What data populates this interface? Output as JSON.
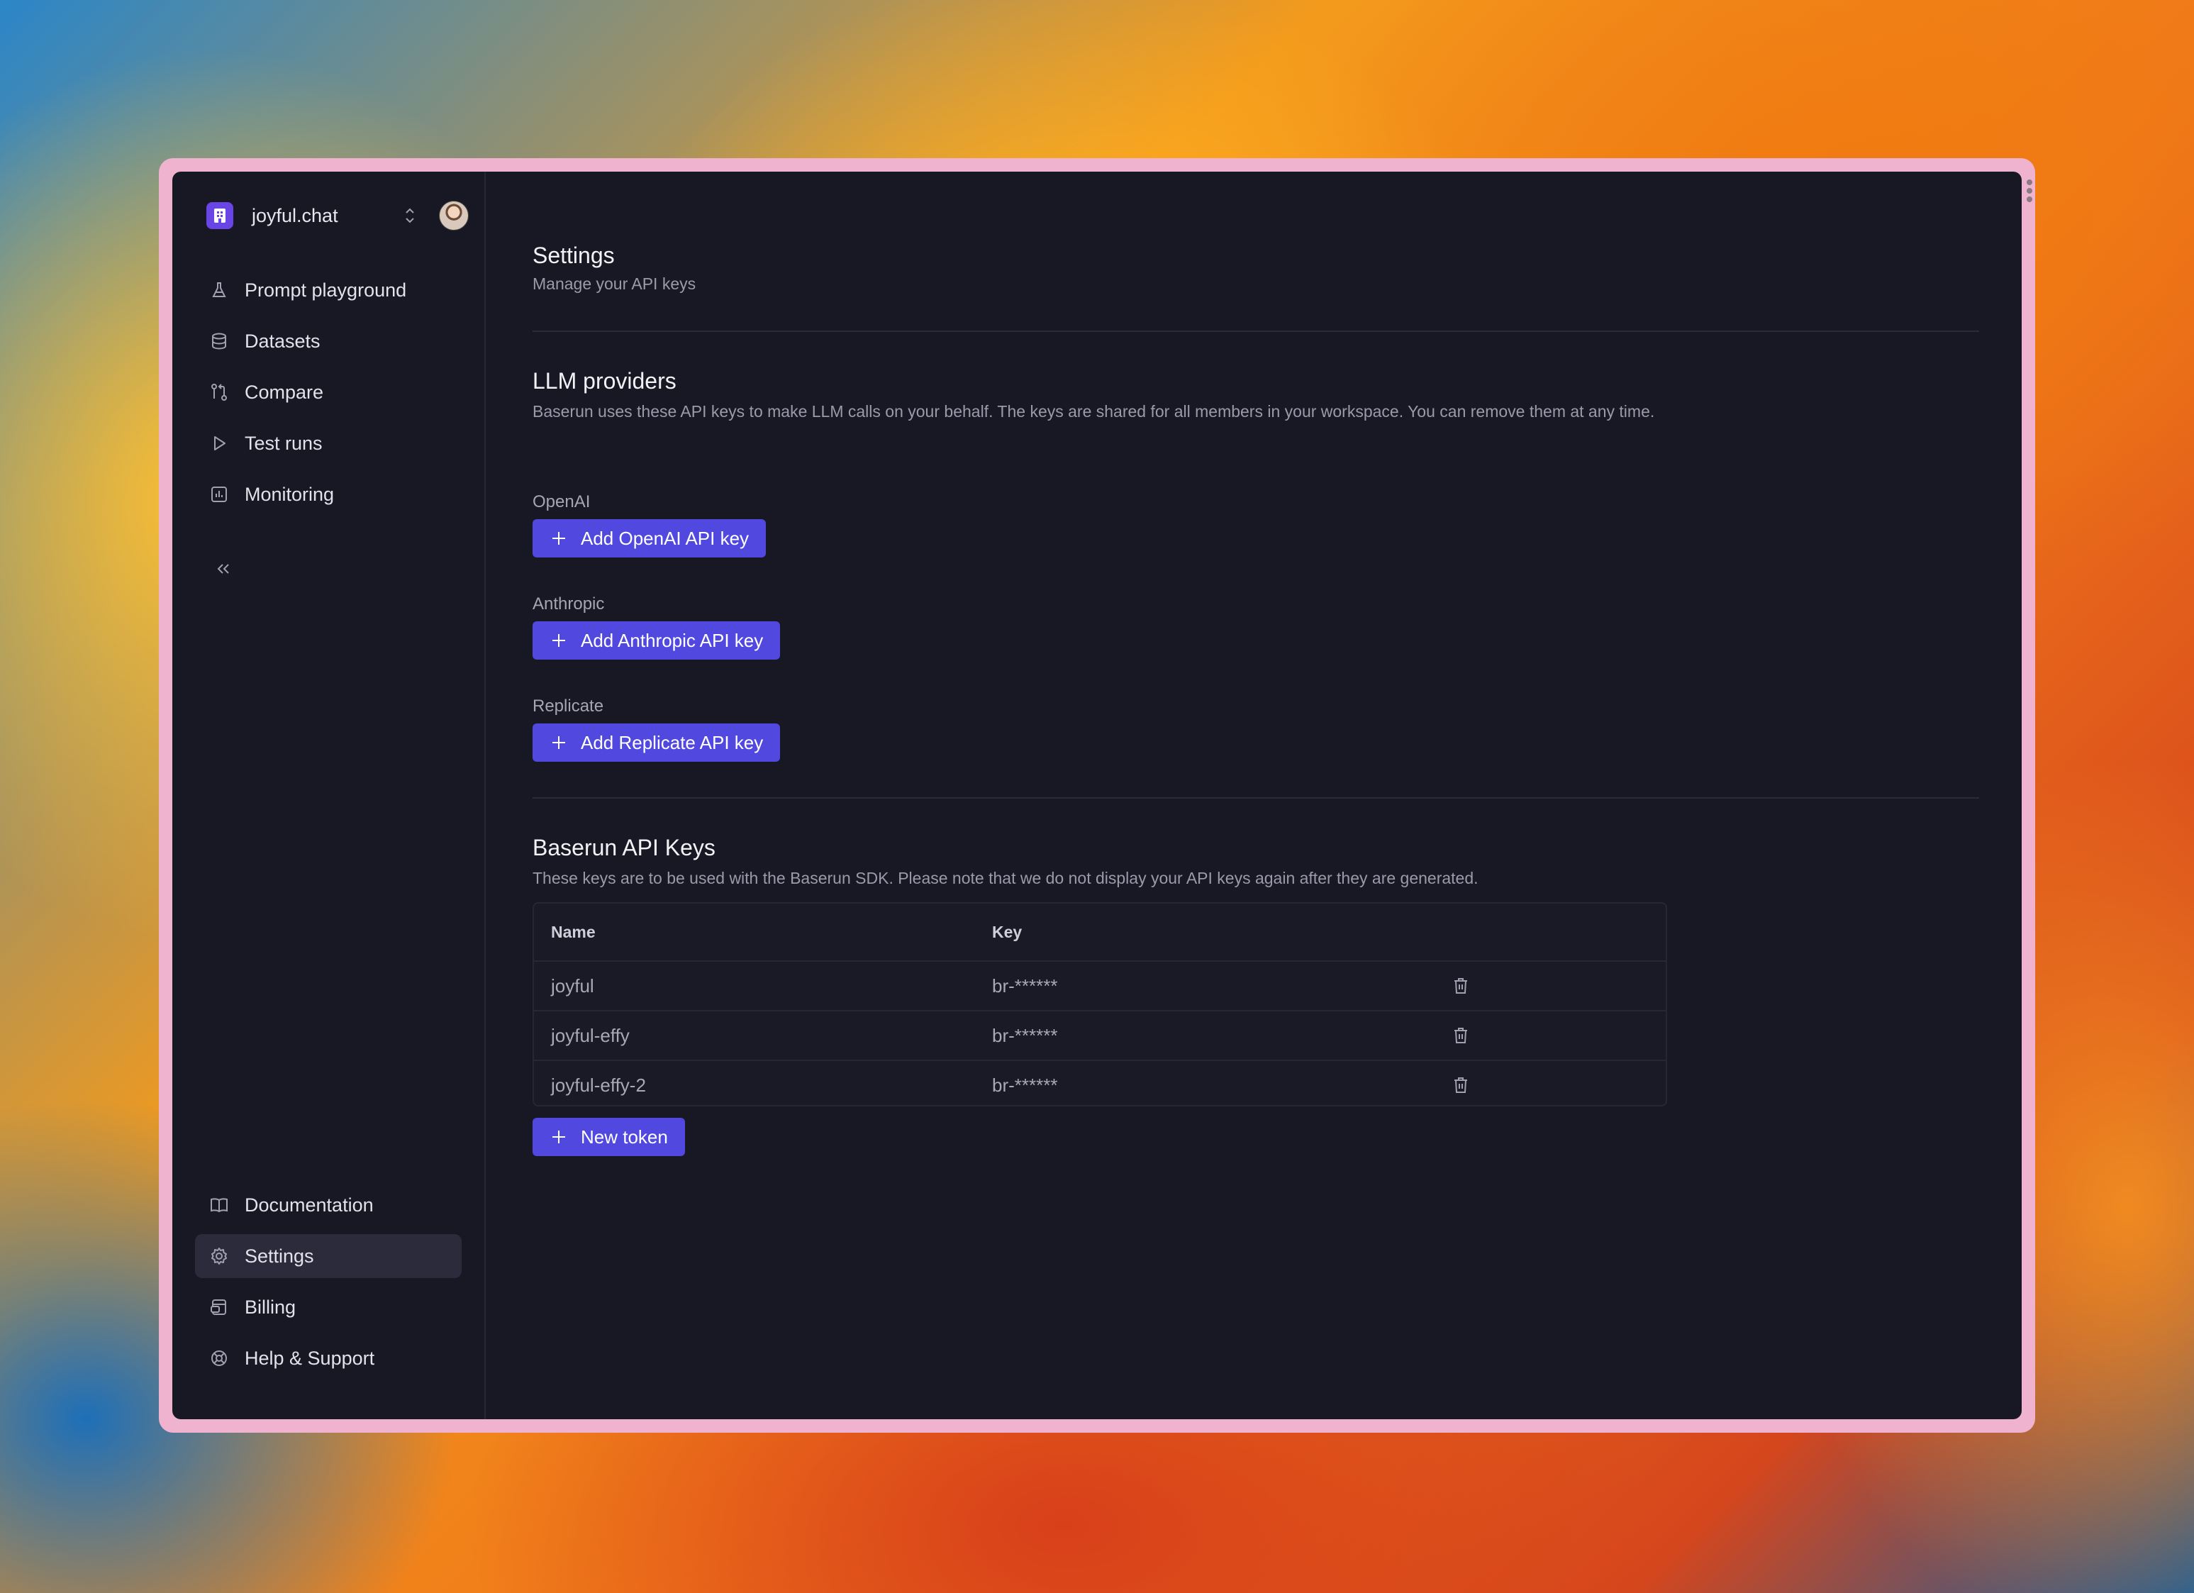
{
  "workspace": {
    "name": "joyful.chat"
  },
  "nav_top": [
    {
      "label": "Prompt playground",
      "icon": "flask-icon"
    },
    {
      "label": "Datasets",
      "icon": "database-icon"
    },
    {
      "label": "Compare",
      "icon": "compare-icon"
    },
    {
      "label": "Test runs",
      "icon": "play-icon"
    },
    {
      "label": "Monitoring",
      "icon": "chart-icon"
    }
  ],
  "nav_bottom": [
    {
      "label": "Documentation",
      "icon": "book-icon"
    },
    {
      "label": "Settings",
      "icon": "gear-icon",
      "active": true
    },
    {
      "label": "Billing",
      "icon": "billing-icon"
    },
    {
      "label": "Help & Support",
      "icon": "lifebuoy-icon"
    }
  ],
  "header": {
    "title": "Settings",
    "subtitle": "Manage your API keys"
  },
  "llm": {
    "title": "LLM providers",
    "description": "Baserun uses these API keys to make LLM calls on your behalf. The keys are shared for all members in your workspace. You can remove them at any time.",
    "providers": [
      {
        "label": "OpenAI",
        "button": "Add OpenAI API key"
      },
      {
        "label": "Anthropic",
        "button": "Add Anthropic API key"
      },
      {
        "label": "Replicate",
        "button": "Add Replicate API key"
      }
    ]
  },
  "keys": {
    "title": "Baserun API Keys",
    "description": "These keys are to be used with the Baserun SDK. Please note that we do not display your API keys again after they are generated.",
    "columns": {
      "name": "Name",
      "key": "Key"
    },
    "rows": [
      {
        "name": "joyful",
        "key": "br-******"
      },
      {
        "name": "joyful-effy",
        "key": "br-******"
      },
      {
        "name": "joyful-effy-2",
        "key": "br-******"
      }
    ],
    "new_button": "New token"
  },
  "colors": {
    "accent": "#5148e0",
    "window_bg": "#181824",
    "frame": "#f0b3cf"
  }
}
